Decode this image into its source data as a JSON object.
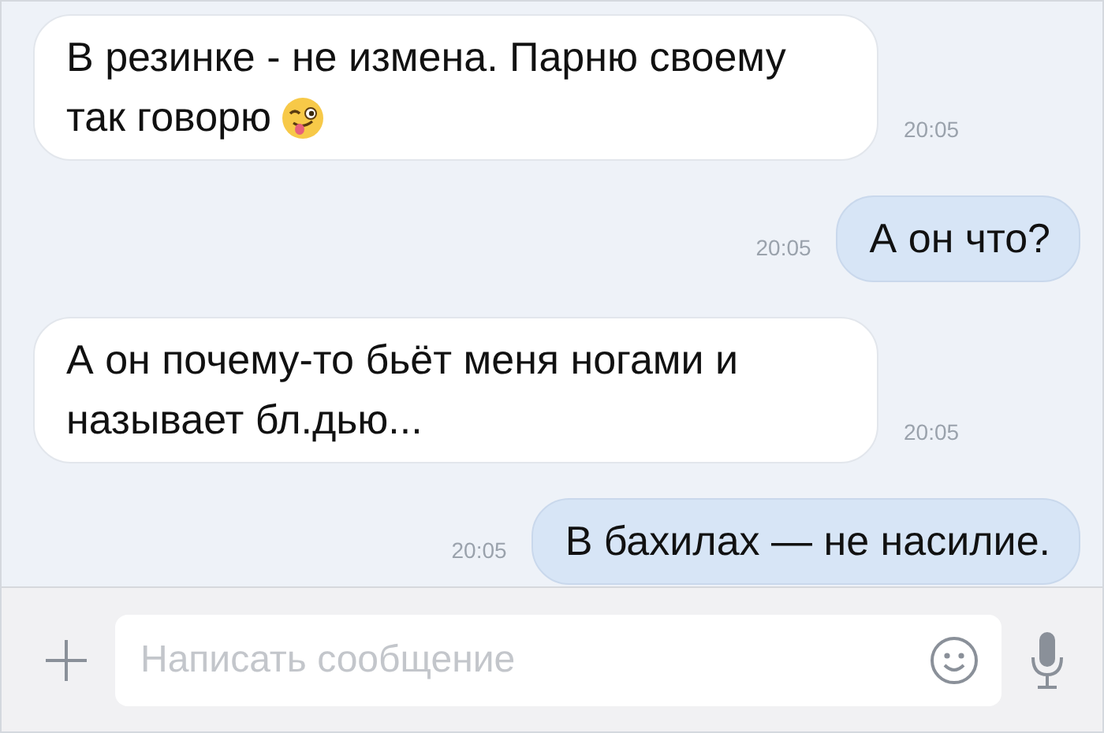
{
  "messages": [
    {
      "kind": "incoming",
      "text": "В резинке - не измена. Парню своему так говорю",
      "emoji": true,
      "time": "20:05"
    },
    {
      "kind": "outgoing",
      "text": "А он что?",
      "time": "20:05"
    },
    {
      "kind": "incoming",
      "text": "А он почему-то бьёт меня ногами и называет бл.дью...",
      "time": "20:05"
    },
    {
      "kind": "outgoing",
      "text": "В бахилах — не насилие.",
      "time": "20:05"
    }
  ],
  "composer": {
    "placeholder": "Написать сообщение"
  }
}
